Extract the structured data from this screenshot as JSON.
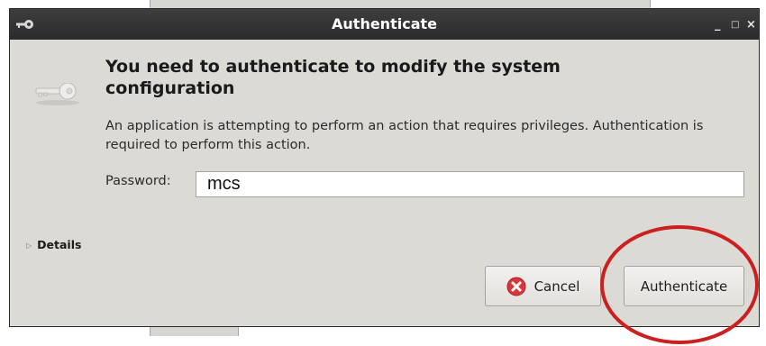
{
  "window": {
    "title": "Authenticate",
    "controls": {
      "minimize": "_",
      "maximize": "□",
      "close": "×"
    }
  },
  "message": {
    "heading": "You need to authenticate to modify the system configuration",
    "description": "An application is attempting to perform an action that requires privileges. Authentication is required to perform this action."
  },
  "password": {
    "label": "Password:",
    "value": "mcs"
  },
  "details": {
    "label": "Details"
  },
  "buttons": {
    "cancel": "Cancel",
    "authenticate": "Authenticate"
  },
  "colors": {
    "titlebar": "#2f2f2f",
    "dialog_bg": "#dcdad5",
    "cancel_icon": "#d9353a",
    "annotation": "#cc1f1f"
  },
  "icons": {
    "app": "key-icon",
    "dialog": "key-icon",
    "cancel": "cancel-icon"
  }
}
